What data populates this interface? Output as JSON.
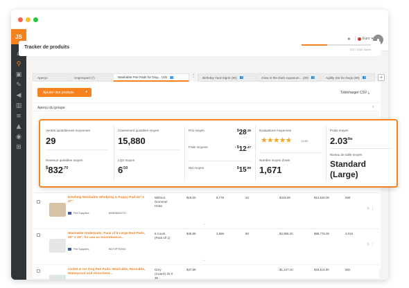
{
  "window": {
    "logo": "JS"
  },
  "sidebar": {
    "items": [
      {
        "name": "home-icon",
        "glyph": "⌂"
      },
      {
        "name": "search-icon",
        "glyph": "⚲"
      },
      {
        "name": "box-icon",
        "glyph": "▣"
      },
      {
        "name": "tools-icon",
        "glyph": "✎"
      },
      {
        "name": "megaphone-icon",
        "glyph": "◀"
      },
      {
        "name": "chart-icon",
        "glyph": "▥"
      },
      {
        "name": "list-icon",
        "glyph": "≡"
      },
      {
        "name": "graduation-icon",
        "glyph": "▲"
      },
      {
        "name": "globe-icon",
        "glyph": "◉"
      },
      {
        "name": "cart-icon",
        "glyph": "⊞"
      }
    ]
  },
  "topbar": {
    "language": "Euro",
    "avatar_glyph": "●"
  },
  "header": {
    "title": "Tracker de produits",
    "progress_fraction": 0.372,
    "progress_text": "372 / 1000 Suivis"
  },
  "tabs": [
    {
      "label": "Aperçu",
      "users": ""
    },
    {
      "label": "Ungrouped (7)",
      "users": ""
    },
    {
      "label": "Washable Pee Pads for Dog... (33)",
      "users": "👥"
    },
    {
      "label": "Birthday Yard Signs (30)",
      "users": "👥"
    },
    {
      "label": "Glow in the Dark Aquarium... (30)",
      "users": "👥"
    },
    {
      "label": "Agility Set for Dogs (30)",
      "users": "👥"
    }
  ],
  "toolbar": {
    "add_products": "Ajouter des produits",
    "download_csv": "Télécharger CSV ⤓",
    "group_overview": "Aperçu du groupe"
  },
  "stats": {
    "avg_daily_sales_label": "Ventes quotidiennes moyennes",
    "avg_daily_sales": "29",
    "avg_daily_revenue_label": "Revenue quotidien moyen",
    "avg_daily_revenue_cur": "$",
    "avg_daily_revenue": "832",
    "avg_daily_revenue_cents": ".70",
    "avg_daily_rank_label": "Classement quotidien moyen",
    "avg_daily_rank": "15,880",
    "lqs_label": "LQS moyen",
    "lqs": "6",
    "lqs_suffix": "/10",
    "avg_price_label": "Prix moyen",
    "avg_price_cur": "$",
    "avg_price": "28",
    "avg_price_cents": ".35",
    "avg_fees_label": "Frais moyens",
    "avg_fees_cur": "- $",
    "avg_fees": "12",
    "avg_fees_cents": ".47",
    "avg_net_label": "Net moyen",
    "avg_net_cur": "$",
    "avg_net": "15",
    "avg_net_cents": ".88",
    "avg_rating_label": "Évaluations moyennes",
    "stars": "★★★★★",
    "rating_value": 4.5,
    "rating_count": "(4.60)",
    "avg_reviews_label": "Nombre moyen d'avis",
    "avg_reviews": "1,671",
    "avg_weight_label": "Poids moyen",
    "avg_weight": "2.03",
    "avg_weight_unit": "lbs",
    "avg_size_label": "Niveau de taille moyen",
    "avg_size_line1": "Standard",
    "avg_size_line2": "(Large)"
  },
  "products": [
    {
      "title": "EZwhelp Washable Whelping & Puppy Pad 41\" x 47\"",
      "category": "Pet Supplies",
      "asin": "B09DB5ZZ7D",
      "variant": "Without\nGrommet\nHoles",
      "price": "$19.00",
      "rank": "8,779",
      "sales": "32",
      "revenue": "$418.00",
      "monthly_revenue": "$12,540.00",
      "reviews": "690"
    },
    {
      "title": "Washable Underpads, Pack of 6 Large Bed Pads, 30\" x 34\", for use as Incontinence...",
      "category": "Pet Supplies",
      "asin": "B07VP752NX",
      "variant": "6 Count\n(Pack Of 1)",
      "price": "$36.99",
      "rank": "3,866",
      "sales": "80",
      "revenue": "$2,959.20",
      "monthly_revenue": "$88,776.00",
      "reviews": "4,016"
    },
    {
      "title": "rocket & rex Dog Pee Pads. Washable, Reusable, Waterproof and Absorbent...",
      "category": "Pet Supplies",
      "asin": "",
      "variant": "Grey\n(2-pack) 32 X\n36",
      "price": "$37.99",
      "rank": "",
      "sales": "",
      "revenue": "$1,137.10",
      "monthly_revenue": "$34,114.00",
      "reviews": "591"
    }
  ]
}
